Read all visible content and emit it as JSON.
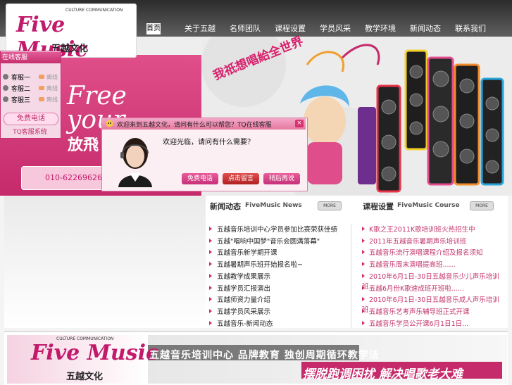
{
  "brand": {
    "logo_text": "Five Music",
    "tagline": "CULTURE COMMUNICATION",
    "cn_name": "五越文化"
  },
  "nav": {
    "items": [
      "首页",
      "关于五越",
      "名师团队",
      "课程设置",
      "学员风采",
      "教学环境",
      "新闻动态",
      "联系我们"
    ]
  },
  "banner": {
    "free_line1": "Free",
    "free_line2": "your",
    "cn_slogan": "放飛",
    "phone": "010-62269626",
    "right_slogan": "我祇想唱給全世界"
  },
  "widget": {
    "title": "在线客服",
    "rows": [
      {
        "label": "客服一",
        "status": "离线"
      },
      {
        "label": "客服二",
        "status": "离线"
      },
      {
        "label": "客服三",
        "status": "离线"
      }
    ],
    "call_button": "免费电话",
    "footer": "TQ客服系统"
  },
  "popup": {
    "title": "欢迎来到五越文化，请问有什么可以帮您？TQ在线客服",
    "message": "欢迎光临，请问有什么需要？",
    "close": "×",
    "buttons": [
      "免费电话",
      "点击留言",
      "稍后再说"
    ]
  },
  "news": {
    "title": "新闻动态",
    "subtitle": "FiveMusic News",
    "more": "MORE",
    "items": [
      "五越音乐培训中心学员参加比赛荣获佳绩",
      "五越\"唱响中国梦\"音乐会圆满落幕\"",
      "五越音乐新学期开课",
      "五越暑期声乐班开始报名啦~",
      "五越教学成果展示",
      "五越学员汇报演出",
      "五越师资力量介绍",
      "五越学员风采展示",
      "五越音乐-新闻动态"
    ]
  },
  "course": {
    "title": "课程设置",
    "subtitle": "FiveMusic Course",
    "more": "MORE",
    "items": [
      "K歌之王2011K歌培训班火热招生中",
      "2011年五越音乐暑期声乐培训班",
      "五越音乐流行演唱课程介绍及报名须知",
      "五越音乐周末演唱提高班......",
      "2010年6月1日-30日五越音乐少儿声乐培训班...",
      "五越6月份K歌速成班开班啦......",
      "2010年6月1日-30日五越音乐成人声乐培训班...",
      "五越音乐艺考声乐辅导班正式开课",
      "五越音乐学员公开课6月1日1日..."
    ]
  },
  "bottom_banner": {
    "line1": "五越音乐培训中心 品牌教育 独创周期循环教学法",
    "line2": "摆脱跑调困扰 解决唱歌老大难"
  },
  "colors": {
    "brand_pink": "#c52a6b",
    "nav_bg": "#333333",
    "link_pink": "#c2356c"
  }
}
